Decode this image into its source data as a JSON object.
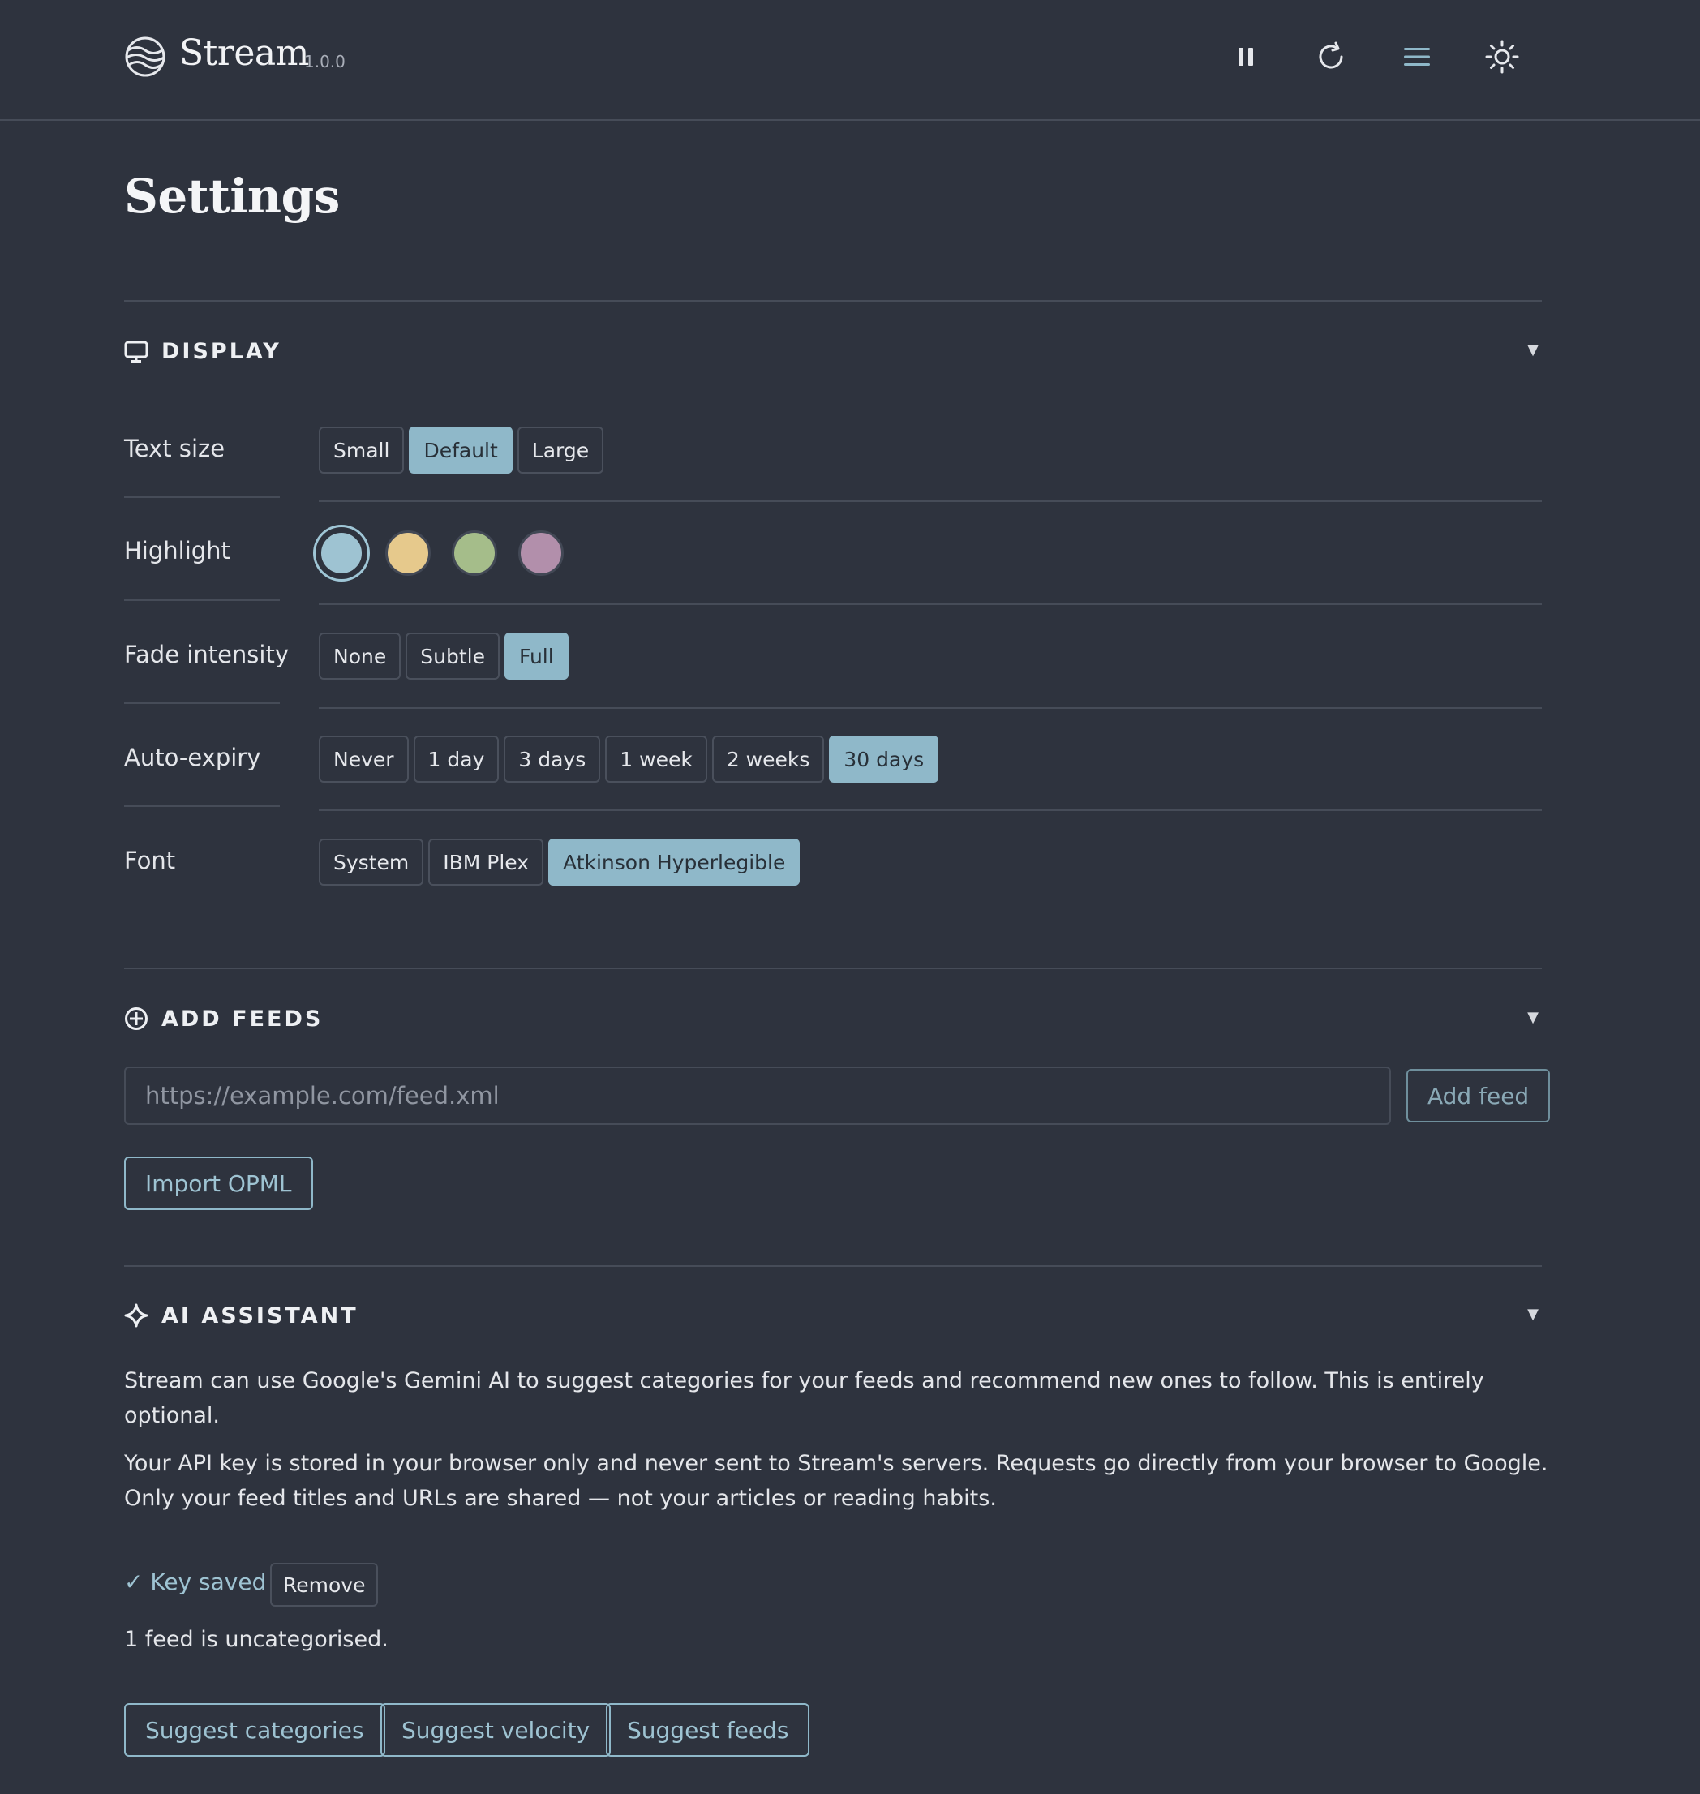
{
  "app": {
    "name": "Stream",
    "version": "1.0.0"
  },
  "page": {
    "title": "Settings"
  },
  "display": {
    "title": "DISPLAY",
    "text_size": {
      "label": "Text size",
      "options": [
        "Small",
        "Default",
        "Large"
      ],
      "selected": "Default"
    },
    "highlight": {
      "label": "Highlight",
      "colors": [
        "#9ec3d2",
        "#e6c98c",
        "#a5bd8a",
        "#b28fab"
      ],
      "selected": 0
    },
    "fade": {
      "label": "Fade intensity",
      "options": [
        "None",
        "Subtle",
        "Full"
      ],
      "selected": "Full"
    },
    "expiry": {
      "label": "Auto-expiry",
      "options": [
        "Never",
        "1 day",
        "3 days",
        "1 week",
        "2 weeks",
        "30 days"
      ],
      "selected": "30 days"
    },
    "font": {
      "label": "Font",
      "options": [
        "System",
        "IBM Plex",
        "Atkinson Hyperlegible"
      ],
      "selected": "Atkinson Hyperlegible"
    }
  },
  "feeds": {
    "title": "ADD FEEDS",
    "placeholder": "https://example.com/feed.xml",
    "add_label": "Add feed",
    "import_label": "Import OPML"
  },
  "ai": {
    "title": "AI ASSISTANT",
    "intro": "Stream can use Google's Gemini AI to suggest categories for your feeds and recommend new ones to follow. This is entirely optional.",
    "privacy": "Your API key is stored in your browser only and never sent to Stream's servers. Requests go directly from your browser to Google. Only your feed titles and URLs are shared — not your articles or reading habits.",
    "key_status": "✓ Key saved",
    "remove_label": "Remove",
    "uncategorised": "1 feed is uncategorised.",
    "actions": [
      "Suggest categories",
      "Suggest velocity",
      "Suggest feeds"
    ]
  },
  "colors": {
    "background": "#2e333e",
    "accent": "#8fb8c9",
    "border": "#464c58"
  }
}
